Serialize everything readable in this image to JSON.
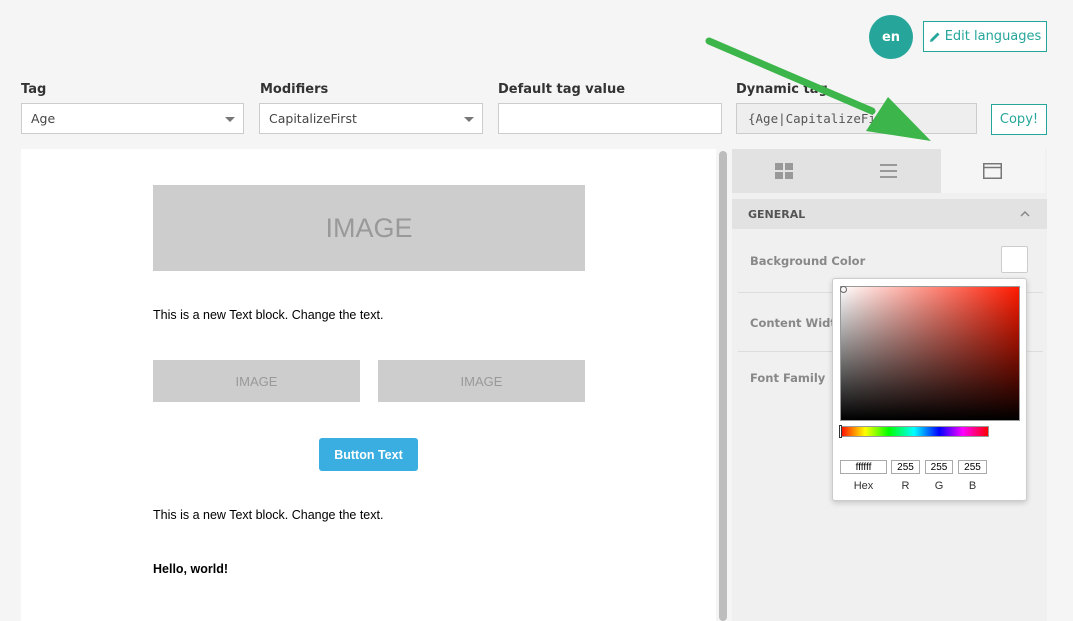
{
  "header": {
    "language_badge": "en",
    "edit_languages_label": "Edit languages"
  },
  "fields": {
    "tag": {
      "label": "Tag",
      "value": "Age"
    },
    "modifiers": {
      "label": "Modifiers",
      "value": "CapitalizeFirst"
    },
    "default_value": {
      "label": "Default tag value",
      "value": ""
    },
    "dynamic_tag": {
      "label": "Dynamic tag",
      "value": "{Age|CapitalizeFirst}"
    },
    "copy_label": "Copy!"
  },
  "canvas": {
    "image_main": "IMAGE",
    "text1": "This is a new Text block. Change the text.",
    "image_left": "IMAGE",
    "image_right": "IMAGE",
    "button": "Button Text",
    "text2": "This is a new Text block. Change the text.",
    "text3": "Hello, world!"
  },
  "panel": {
    "tabs": [
      "content-tab",
      "rows-tab",
      "settings-tab"
    ],
    "active_tab": 2,
    "section": "GENERAL",
    "props": {
      "background_color": "Background Color",
      "content_width": "Content Width",
      "font_family": "Font Family"
    }
  },
  "color_picker": {
    "hex": "ffffff",
    "r": "255",
    "g": "255",
    "b": "255",
    "labels": {
      "hex": "Hex",
      "r": "R",
      "g": "G",
      "b": "B"
    }
  },
  "colors": {
    "accent": "#26a69a",
    "email_button": "#3aaee0",
    "arrow": "#3cb54a"
  }
}
